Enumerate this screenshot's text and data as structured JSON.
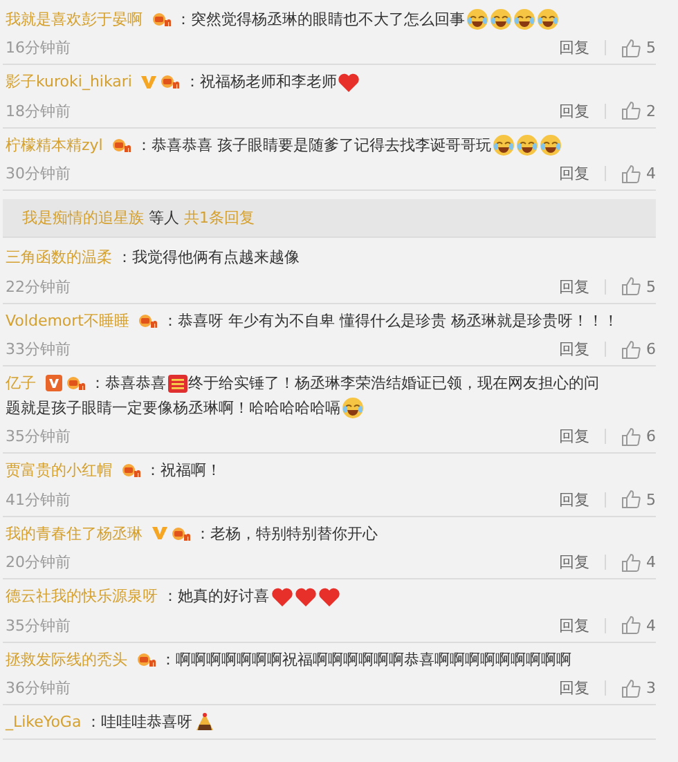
{
  "comments": [
    {
      "name": "我就是喜欢彭于晏啊",
      "badges": [
        {
          "kind": "fan"
        }
      ],
      "parts": [
        {
          "kind": "text",
          "text": "：突然觉得杨丞琳的眼睛也不大了怎么回事"
        },
        {
          "kind": "laugh"
        },
        {
          "kind": "laugh"
        },
        {
          "kind": "laugh"
        },
        {
          "kind": "laugh"
        }
      ],
      "time": "16分钟前",
      "reply": "回复",
      "likes": "5"
    },
    {
      "name": "影子kuroki_hikari",
      "badges": [
        {
          "kind": "verified"
        },
        {
          "kind": "fan"
        }
      ],
      "parts": [
        {
          "kind": "text",
          "text": "：祝福杨老师和李老师"
        },
        {
          "kind": "heart"
        }
      ],
      "time": "18分钟前",
      "reply": "回复",
      "likes": "2"
    },
    {
      "name": "柠檬精本精zyl",
      "badges": [
        {
          "kind": "fan"
        }
      ],
      "parts": [
        {
          "kind": "text",
          "text": "：恭喜恭喜 孩子眼睛要是随爹了记得去找李诞哥哥玩"
        },
        {
          "kind": "laugh"
        },
        {
          "kind": "laugh"
        },
        {
          "kind": "laugh"
        }
      ],
      "time": "30分钟前",
      "reply": "回复",
      "likes": "4"
    },
    {
      "kind": "summary",
      "name": "我是痴情的追星族",
      "middle": "等人",
      "count": "共1条回复"
    },
    {
      "name": "三角函数的温柔",
      "parts": [
        {
          "kind": "text",
          "text": "：我觉得他俩有点越来越像"
        }
      ],
      "time": "22分钟前",
      "reply": "回复",
      "likes": "5"
    },
    {
      "name": "Voldemort不睡睡",
      "badges": [
        {
          "kind": "fan"
        }
      ],
      "parts": [
        {
          "kind": "text",
          "text": "：恭喜呀 年少有为不自卑 懂得什么是珍贵 杨丞琳就是珍贵呀！！！"
        }
      ],
      "time": "33分钟前",
      "reply": "回复",
      "likes": "6"
    },
    {
      "name": "亿子",
      "badges": [
        {
          "kind": "vip"
        },
        {
          "kind": "fan"
        }
      ],
      "parts": [
        {
          "kind": "text",
          "text": "：恭喜恭喜"
        },
        {
          "kind": "xi"
        },
        {
          "kind": "text",
          "text": "终于给实锤了！杨丞琳李荣浩结婚证已领，现在网友担心的问"
        },
        {
          "kind": "text",
          "text": "题就是孩子眼睛一定要像杨丞琳啊！哈哈哈哈哈嗝"
        },
        {
          "kind": "laugh"
        }
      ],
      "time": "35分钟前",
      "reply": "回复",
      "likes": "6"
    },
    {
      "name": "贾富贵的小红帽",
      "badges": [
        {
          "kind": "fan"
        }
      ],
      "parts": [
        {
          "kind": "text",
          "text": "：祝福啊！"
        }
      ],
      "time": "41分钟前",
      "reply": "回复",
      "likes": "5"
    },
    {
      "name": "我的青春住了杨丞琳",
      "badges": [
        {
          "kind": "verified"
        },
        {
          "kind": "fan"
        }
      ],
      "parts": [
        {
          "kind": "text",
          "text": "：老杨，特别特别替你开心"
        }
      ],
      "time": "20分钟前",
      "reply": "回复",
      "likes": "4"
    },
    {
      "name": "德云社我的快乐源泉呀",
      "parts": [
        {
          "kind": "text",
          "text": "：她真的好讨喜"
        },
        {
          "kind": "heart"
        },
        {
          "kind": "heart"
        },
        {
          "kind": "heart"
        }
      ],
      "time": "35分钟前",
      "reply": "回复",
      "likes": "4"
    },
    {
      "name": "拯救发际线的秃头",
      "badges": [
        {
          "kind": "fan"
        }
      ],
      "parts": [
        {
          "kind": "text",
          "text": "：啊啊啊啊啊啊啊祝福啊啊啊啊啊啊恭喜啊啊啊啊啊啊啊啊啊"
        }
      ],
      "time": "36分钟前",
      "reply": "回复",
      "likes": "3"
    },
    {
      "name": "_LikeYoGa",
      "parts": [
        {
          "kind": "text",
          "text": "：哇哇哇恭喜呀"
        },
        {
          "kind": "cake"
        }
      ]
    }
  ]
}
